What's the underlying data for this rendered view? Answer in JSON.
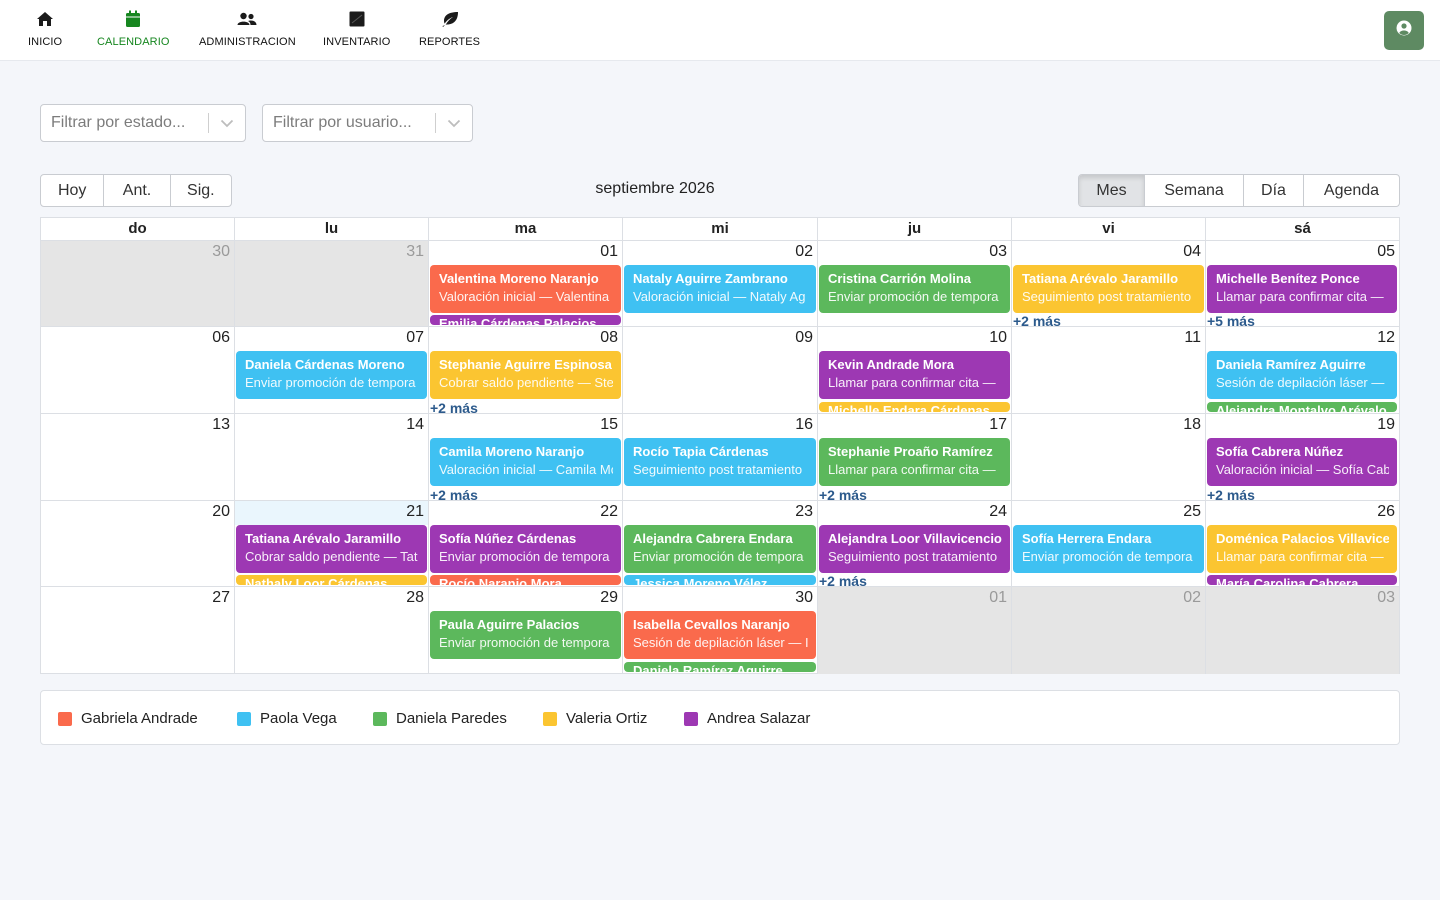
{
  "nav": {
    "items": [
      {
        "label": "INICIO",
        "icon": "home-icon"
      },
      {
        "label": "CALENDARIO",
        "icon": "calendar-icon",
        "active": true
      },
      {
        "label": "ADMINISTRACION",
        "icon": "users-icon"
      },
      {
        "label": "INVENTARIO",
        "icon": "inventory-icon"
      },
      {
        "label": "REPORTES",
        "icon": "leaf-icon"
      }
    ],
    "user_icon": "user-circle-icon"
  },
  "filters": {
    "status_placeholder": "Filtrar por estado...",
    "user_placeholder": "Filtrar por usuario..."
  },
  "toolbar": {
    "today": "Hoy",
    "prev": "Ant.",
    "next": "Sig.",
    "title": "septiembre 2026",
    "views": [
      "Mes",
      "Semana",
      "Día",
      "Agenda"
    ],
    "active_view": "Mes"
  },
  "colors": {
    "Gabriela Andrade": "#fa6a4c",
    "Paola Vega": "#3fc1f2",
    "Daniela Paredes": "#5cb85c",
    "Valeria Ortiz": "#fbc531",
    "Andrea Salazar": "#9d38b3",
    "nav_active": "#16861f",
    "link": "#2c5a8c"
  },
  "calendar": {
    "weekdays": [
      "do",
      "lu",
      "ma",
      "mi",
      "ju",
      "vi",
      "sá"
    ],
    "weeks": [
      {
        "days": [
          {
            "n": "30",
            "off": true
          },
          {
            "n": "31",
            "off": true
          },
          {
            "n": "01",
            "events": [
              {
                "title": "Valentina Moreno Naranjo",
                "sub": "Valoración inicial — Valentina",
                "owner": "Gabriela Andrade"
              }
            ],
            "peek": {
              "title": "Emilia Cárdenas Palacios",
              "owner": "Andrea Salazar"
            }
          },
          {
            "n": "02",
            "events": [
              {
                "title": "Nataly Aguirre Zambrano",
                "sub": "Valoración inicial — Nataly Ag",
                "owner": "Paola Vega"
              }
            ]
          },
          {
            "n": "03",
            "events": [
              {
                "title": "Cristina Carrión Molina",
                "sub": "Enviar promoción de tempora",
                "owner": "Daniela Paredes"
              }
            ]
          },
          {
            "n": "04",
            "events": [
              {
                "title": "Tatiana Arévalo Jaramillo",
                "sub": "Seguimiento post tratamiento",
                "owner": "Valeria Ortiz"
              }
            ],
            "more": "+2 más"
          },
          {
            "n": "05",
            "events": [
              {
                "title": "Michelle Benítez Ponce",
                "sub": "Llamar para confirmar cita —",
                "owner": "Andrea Salazar"
              }
            ],
            "more": "+5 más"
          }
        ]
      },
      {
        "days": [
          {
            "n": "06"
          },
          {
            "n": "07",
            "events": [
              {
                "title": "Daniela Cárdenas Moreno",
                "sub": "Enviar promoción de tempora",
                "owner": "Paola Vega"
              }
            ]
          },
          {
            "n": "08",
            "events": [
              {
                "title": "Stephanie Aguirre Espinosa",
                "sub": "Cobrar saldo pendiente — Ste",
                "owner": "Valeria Ortiz"
              }
            ],
            "more": "+2 más"
          },
          {
            "n": "09"
          },
          {
            "n": "10",
            "events": [
              {
                "title": "Kevin Andrade Mora",
                "sub": "Llamar para confirmar cita —",
                "owner": "Andrea Salazar"
              }
            ],
            "peek": {
              "title": "Michelle Endara Cárdenas",
              "owner": "Valeria Ortiz"
            }
          },
          {
            "n": "11"
          },
          {
            "n": "12",
            "events": [
              {
                "title": "Daniela Ramírez Aguirre",
                "sub": "Sesión de depilación láser — D",
                "owner": "Paola Vega"
              }
            ],
            "peek": {
              "title": "Alejandra Montalvo Arévalo",
              "owner": "Daniela Paredes"
            }
          }
        ]
      },
      {
        "days": [
          {
            "n": "13"
          },
          {
            "n": "14"
          },
          {
            "n": "15",
            "events": [
              {
                "title": "Camila Moreno Naranjo",
                "sub": "Valoración inicial — Camila Mo",
                "owner": "Paola Vega"
              }
            ],
            "more": "+2 más"
          },
          {
            "n": "16",
            "events": [
              {
                "title": "Rocío Tapia Cárdenas",
                "sub": "Seguimiento post tratamiento",
                "owner": "Paola Vega"
              }
            ]
          },
          {
            "n": "17",
            "events": [
              {
                "title": "Stephanie Proaño Ramírez",
                "sub": "Llamar para confirmar cita —",
                "owner": "Daniela Paredes"
              }
            ],
            "more": "+2 más"
          },
          {
            "n": "18"
          },
          {
            "n": "19",
            "events": [
              {
                "title": "Sofía Cabrera Núñez",
                "sub": "Valoración inicial — Sofía Cabr",
                "owner": "Andrea Salazar"
              }
            ],
            "more": "+2 más"
          }
        ]
      },
      {
        "days": [
          {
            "n": "20"
          },
          {
            "n": "21",
            "today": true,
            "events": [
              {
                "title": "Tatiana Arévalo Jaramillo",
                "sub": "Cobrar saldo pendiente — Tat",
                "owner": "Andrea Salazar"
              }
            ],
            "peek": {
              "title": "Nathaly Loor Cárdenas",
              "owner": "Valeria Ortiz"
            }
          },
          {
            "n": "22",
            "events": [
              {
                "title": "Sofía Núñez Cárdenas",
                "sub": "Enviar promoción de tempora",
                "owner": "Andrea Salazar"
              }
            ],
            "peek": {
              "title": "Rocío Naranjo Mora",
              "owner": "Gabriela Andrade"
            }
          },
          {
            "n": "23",
            "events": [
              {
                "title": "Alejandra Cabrera Endara",
                "sub": "Enviar promoción de tempora",
                "owner": "Daniela Paredes"
              }
            ],
            "peek": {
              "title": "Jessica Moreno Vélez",
              "owner": "Paola Vega"
            }
          },
          {
            "n": "24",
            "events": [
              {
                "title": "Alejandra Loor Villavicencio",
                "sub": "Seguimiento post tratamiento",
                "owner": "Andrea Salazar"
              }
            ],
            "more": "+2 más"
          },
          {
            "n": "25",
            "events": [
              {
                "title": "Sofía Herrera Endara",
                "sub": "Enviar promoción de tempora",
                "owner": "Paola Vega"
              }
            ]
          },
          {
            "n": "26",
            "events": [
              {
                "title": "Doménica Palacios Villavicencio",
                "sub": "Llamar para confirmar cita —",
                "owner": "Valeria Ortiz"
              }
            ],
            "peek": {
              "title": "María Carolina Cabrera",
              "owner": "Andrea Salazar"
            }
          }
        ]
      },
      {
        "days": [
          {
            "n": "27"
          },
          {
            "n": "28"
          },
          {
            "n": "29",
            "events": [
              {
                "title": "Paula Aguirre Palacios",
                "sub": "Enviar promoción de tempora",
                "owner": "Daniela Paredes"
              }
            ]
          },
          {
            "n": "30",
            "events": [
              {
                "title": "Isabella Cevallos Naranjo",
                "sub": "Sesión de depilación láser — I",
                "owner": "Gabriela Andrade"
              }
            ],
            "peek": {
              "title": "Daniela Ramírez Aguirre",
              "owner": "Daniela Paredes"
            }
          },
          {
            "n": "01",
            "off": true
          },
          {
            "n": "02",
            "off": true
          },
          {
            "n": "03",
            "off": true
          }
        ]
      }
    ]
  },
  "legend": [
    {
      "name": "Gabriela Andrade",
      "color": "#fa6a4c"
    },
    {
      "name": "Paola Vega",
      "color": "#3fc1f2"
    },
    {
      "name": "Daniela Paredes",
      "color": "#5cb85c"
    },
    {
      "name": "Valeria Ortiz",
      "color": "#fbc531"
    },
    {
      "name": "Andrea Salazar",
      "color": "#9d38b3"
    }
  ]
}
